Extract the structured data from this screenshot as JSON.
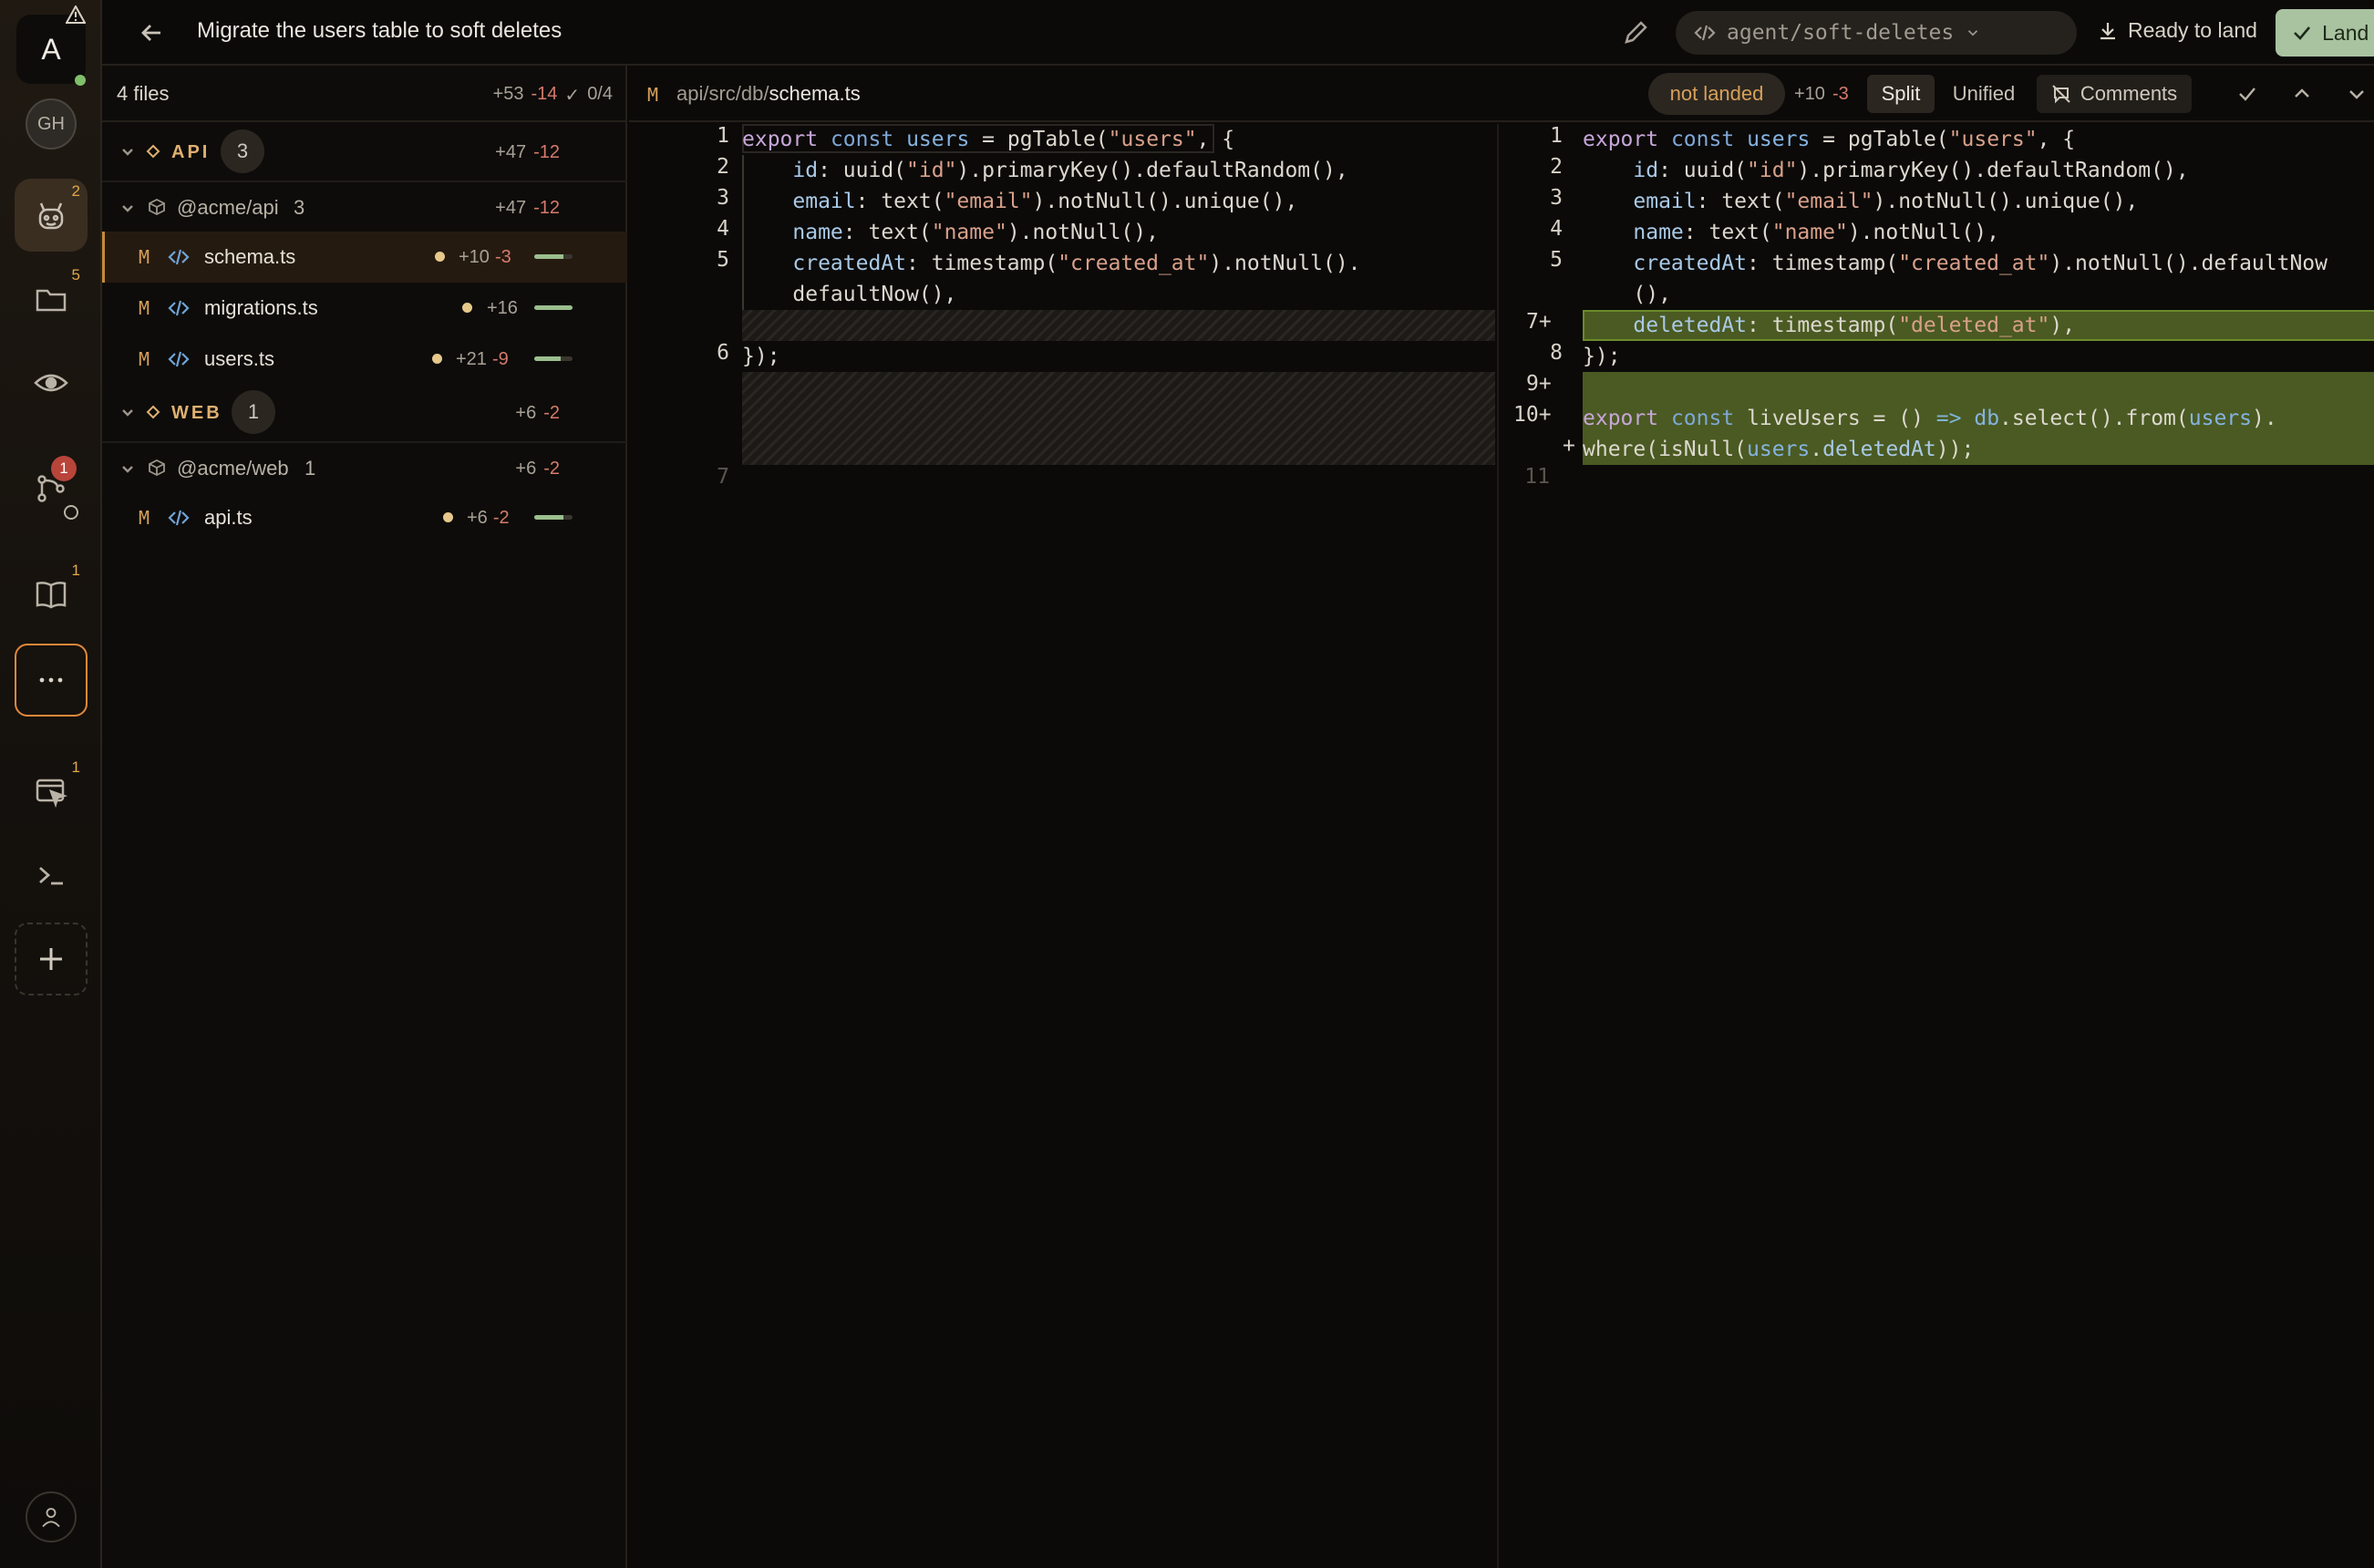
{
  "rail": {
    "avatar_letter": "A",
    "gh_label": "GH",
    "badges": {
      "agents": "2",
      "files": "5",
      "branches": "1",
      "docs": "1",
      "browser": "1"
    }
  },
  "topbar": {
    "title": "Migrate the users table to soft deletes",
    "branch": "agent/soft-deletes",
    "ready_label": "Ready to land",
    "land_label": "Land now"
  },
  "tree": {
    "files_count": "4 files",
    "total_add": "+53",
    "total_del": "-14",
    "reviewed": "0/4",
    "groups": [
      {
        "label": "API",
        "count": "3",
        "add": "+47",
        "del": "-12",
        "package": {
          "name": "@acme/api",
          "count": "3",
          "add": "+47",
          "del": "-12"
        },
        "files": [
          {
            "status": "M",
            "name": "schema.ts",
            "add": "+10",
            "del": "-3",
            "ratio": 0.77
          },
          {
            "status": "M",
            "name": "migrations.ts",
            "add": "+16",
            "del": "",
            "ratio": 1.0
          },
          {
            "status": "M",
            "name": "users.ts",
            "add": "+21",
            "del": "-9",
            "ratio": 0.7
          }
        ]
      },
      {
        "label": "WEB",
        "count": "1",
        "add": "+6",
        "del": "-2",
        "package": {
          "name": "@acme/web",
          "count": "1",
          "add": "+6",
          "del": "-2"
        },
        "files": [
          {
            "status": "M",
            "name": "api.ts",
            "add": "+6",
            "del": "-2",
            "ratio": 0.75
          }
        ]
      }
    ]
  },
  "diff": {
    "status": "M",
    "path_prefix": "api/src/db/",
    "path_file": "schema.ts",
    "landed_status": "not landed",
    "add": "+10",
    "del": "-3",
    "split_label": "Split",
    "unified_label": "Unified",
    "comments_label": "Comments",
    "left_line_numbers": [
      "1",
      "2",
      "3",
      "4",
      "5",
      "6",
      "7"
    ],
    "right_line_numbers": [
      "1",
      "2",
      "3",
      "4",
      "5",
      "7+",
      "8",
      "9+",
      "10+",
      "+",
      "11"
    ]
  }
}
